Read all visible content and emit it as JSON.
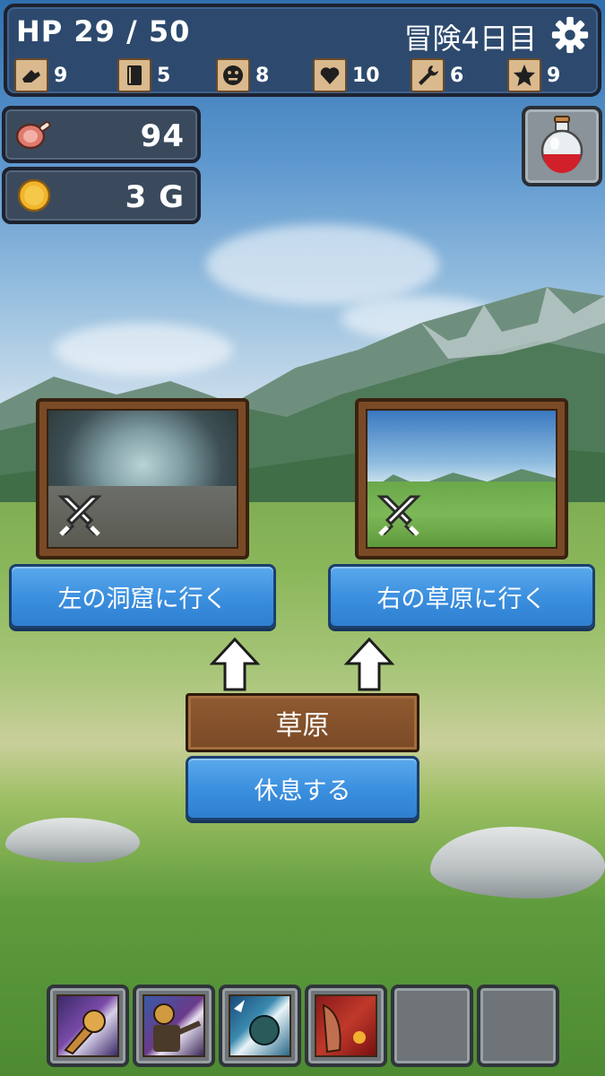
{
  "status": {
    "hp_text": "HP 29 / 50",
    "day_text": "冒険4日目",
    "stats": [
      {
        "icon": "boot-icon",
        "value": "9"
      },
      {
        "icon": "book-icon",
        "value": "5"
      },
      {
        "icon": "face-icon",
        "value": "8"
      },
      {
        "icon": "heart-icon",
        "value": "10"
      },
      {
        "icon": "wrench-icon",
        "value": "6"
      },
      {
        "icon": "star-icon",
        "value": "9"
      }
    ]
  },
  "resources": {
    "food": {
      "icon": "meat-icon",
      "value": "94"
    },
    "gold": {
      "icon": "coin-icon",
      "value": "3 G"
    }
  },
  "choices": {
    "left": {
      "scene": "cave",
      "label": "左の洞窟に行く",
      "icon": "crossed-swords-icon"
    },
    "right": {
      "scene": "grassland",
      "label": "右の草原に行く",
      "icon": "crossed-swords-icon"
    }
  },
  "location": {
    "name": "草原"
  },
  "rest_button": {
    "label": "休息する"
  },
  "skills": [
    {
      "name": "punch-skill-icon",
      "filled": true
    },
    {
      "name": "slash-skill-icon",
      "filled": true
    },
    {
      "name": "wave-skill-icon",
      "filled": true
    },
    {
      "name": "flame-skill-icon",
      "filled": true
    },
    {
      "name": "empty-slot",
      "filled": false
    },
    {
      "name": "empty-slot",
      "filled": false
    }
  ],
  "colors": {
    "panel": "#2d4a6e",
    "button_blue": "#3a8ede",
    "wood": "#7a4a26"
  }
}
